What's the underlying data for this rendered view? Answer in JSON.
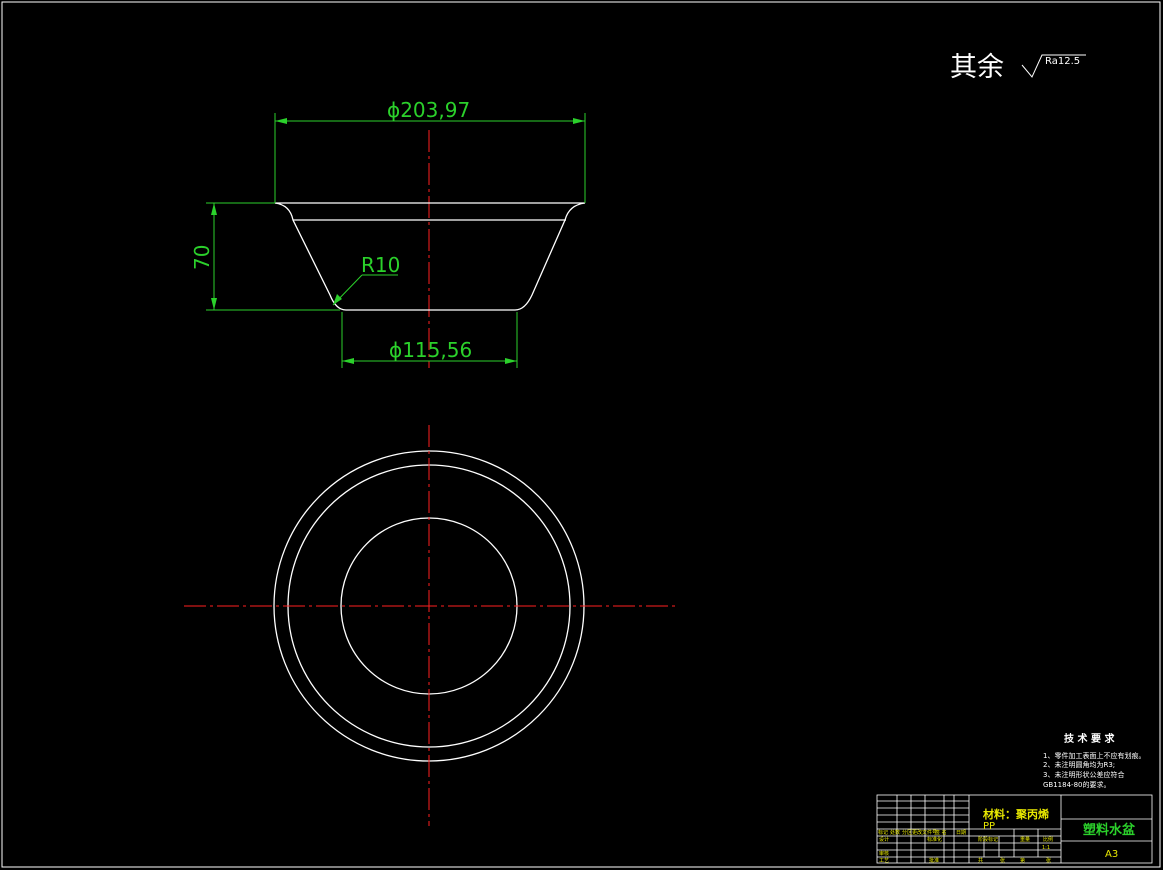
{
  "surface_finish": {
    "label": "其余",
    "value": "Ra12.5"
  },
  "dimensions": {
    "top_diameter": "ϕ203,97",
    "height": "70",
    "radius": "R10",
    "bottom_diameter": "ϕ115,56"
  },
  "tech_requirements": {
    "title": "技 术 要 求",
    "items": [
      "1、零件加工表面上不应有划痕。",
      "2、未注明圆角均为R3;",
      "3、未注明形状公差应符合",
      "GB1184-80的要求。"
    ]
  },
  "title_block": {
    "material_label": "材料：聚丙烯",
    "material_code": "PP",
    "part_name": "塑料水盆",
    "sheet_size": "A3",
    "scale": "1:1",
    "header_cells": [
      "标记",
      "处数",
      "分区",
      "更改文件号",
      "签 名",
      "日期"
    ],
    "row_labels": [
      "设计",
      "审核",
      "工艺"
    ],
    "std_label": "标准化",
    "approve_label": "批准",
    "stage_labels": [
      "阶段标记",
      "重量",
      "比例"
    ],
    "sheet_labels": [
      "共",
      "张",
      "第",
      "张"
    ]
  },
  "colors": {
    "background": "#000000",
    "outline": "#ffffff",
    "dimension": "#2bd12b",
    "centerline": "#ff2020",
    "table_text": "#e8e800"
  }
}
